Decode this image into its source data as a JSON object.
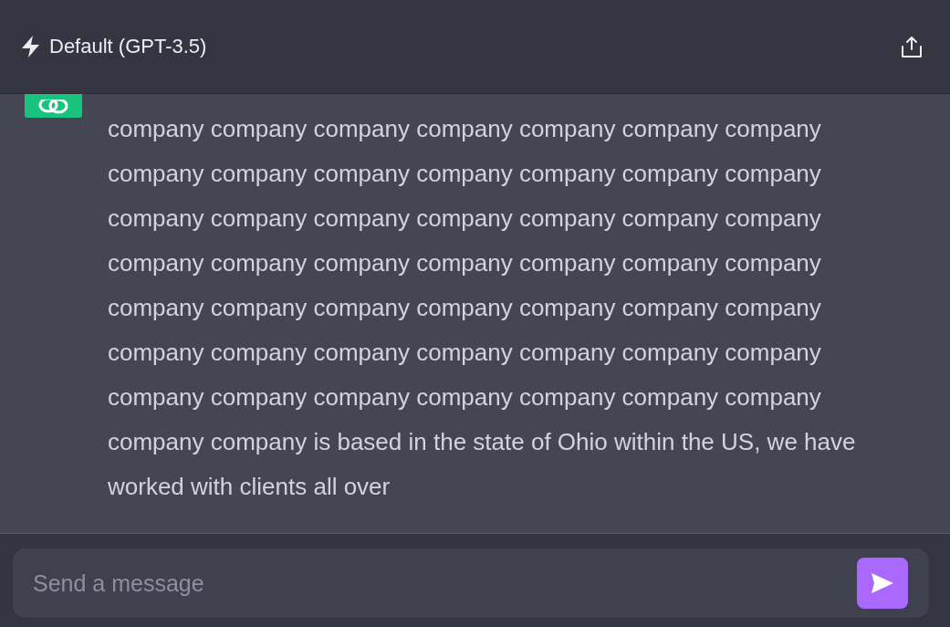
{
  "header": {
    "model": "Default (GPT-3.5)"
  },
  "message": {
    "text": "company company company company company company company company company company company company company company company company company company company company company company company company company company company company company company company company company company company company company company company company company company company company company company company company company company company is based in the state of Ohio within the US, we have worked with clients all over"
  },
  "composer": {
    "placeholder": "Send a message"
  }
}
